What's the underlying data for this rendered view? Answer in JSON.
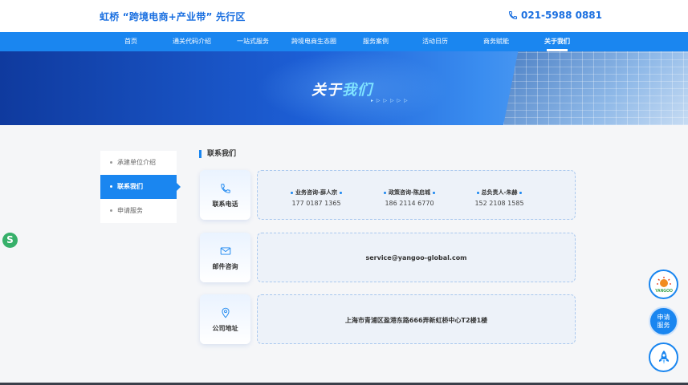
{
  "header": {
    "brand": "虹桥 “跨境电商+产业带” 先行区",
    "phone": "021-5988 0881"
  },
  "nav": {
    "items": [
      {
        "label": "首页"
      },
      {
        "label": "通关代码介绍"
      },
      {
        "label": "一站式服务"
      },
      {
        "label": "跨境电商生态圈"
      },
      {
        "label": "服务案例"
      },
      {
        "label": "活动日历"
      },
      {
        "label": "商务赋能"
      },
      {
        "label": "关于我们",
        "active": true
      }
    ]
  },
  "banner": {
    "title_part1": "关于",
    "title_part2": "我们",
    "deco": "▸ ▷ ▷ ▷ ▷ ▷"
  },
  "sidebar": {
    "items": [
      {
        "label": "承建单位介绍"
      },
      {
        "label": "联系我们",
        "active": true
      },
      {
        "label": "申请服务"
      }
    ]
  },
  "main": {
    "section_title": "联系我们",
    "phone_card": {
      "label": "联系电话",
      "contacts": [
        {
          "name": "业务咨询-薛人宗",
          "number": "177 0187 1365"
        },
        {
          "name": "政策咨询-陈启城",
          "number": "186 2114 6770"
        },
        {
          "name": "总负责人-朱赫",
          "number": "152 2108 1585"
        }
      ]
    },
    "email_card": {
      "label": "邮件咨询",
      "value": "service@yangoo-global.com"
    },
    "address_card": {
      "label": "公司地址",
      "value": "上海市青浦区盈港东路666弄新虹桥中心T2楼1楼"
    }
  },
  "floating": {
    "apply_label_1": "申请",
    "apply_label_2": "服务",
    "logo_text": "YANGOO",
    "left_badge": "S"
  },
  "colors": {
    "primary": "#1a86f0",
    "brand_text": "#1a6fe0",
    "card_bg": "#edf2f9"
  }
}
